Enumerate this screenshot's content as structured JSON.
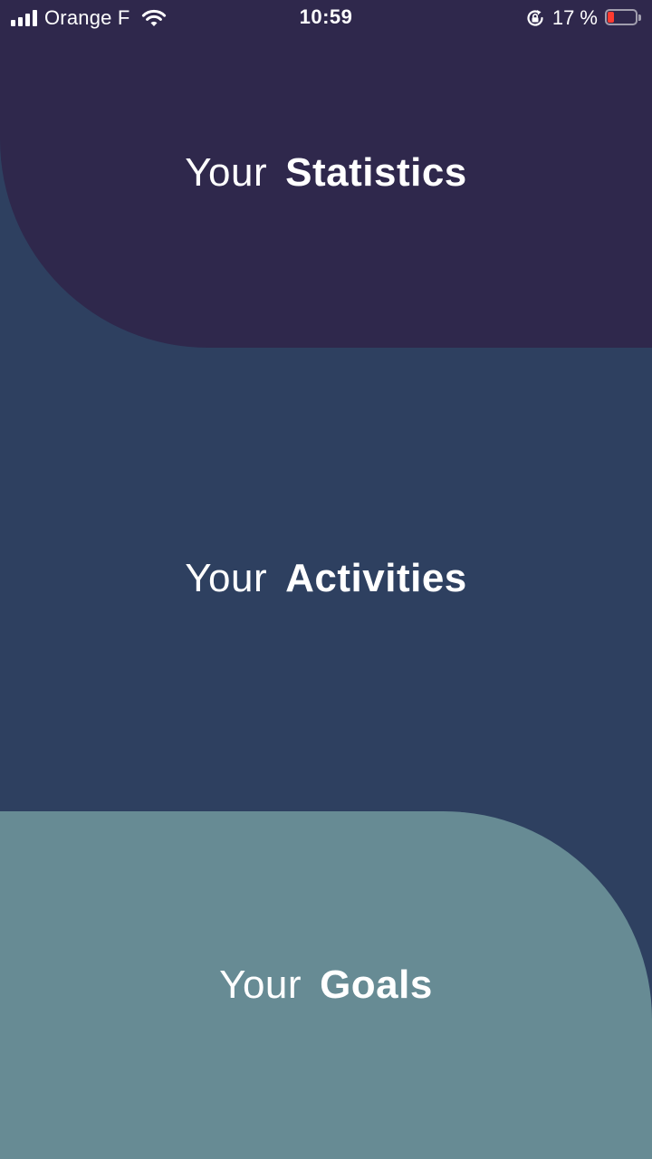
{
  "status_bar": {
    "carrier": "Orange F",
    "time": "10:59",
    "battery_percent": "17 %",
    "battery_level": 0.17,
    "battery_color": "#ff3b30",
    "icons": [
      "signal-icon",
      "wifi-icon",
      "rotation-lock-icon",
      "battery-icon"
    ]
  },
  "sections": {
    "statistics": {
      "prefix": "Your",
      "title": "Statistics",
      "color": "#2f284c"
    },
    "activities": {
      "prefix": "Your",
      "title": "Activities",
      "color": "#2e4060"
    },
    "goals": {
      "prefix": "Your",
      "title": "Goals",
      "color": "#678b94"
    }
  }
}
